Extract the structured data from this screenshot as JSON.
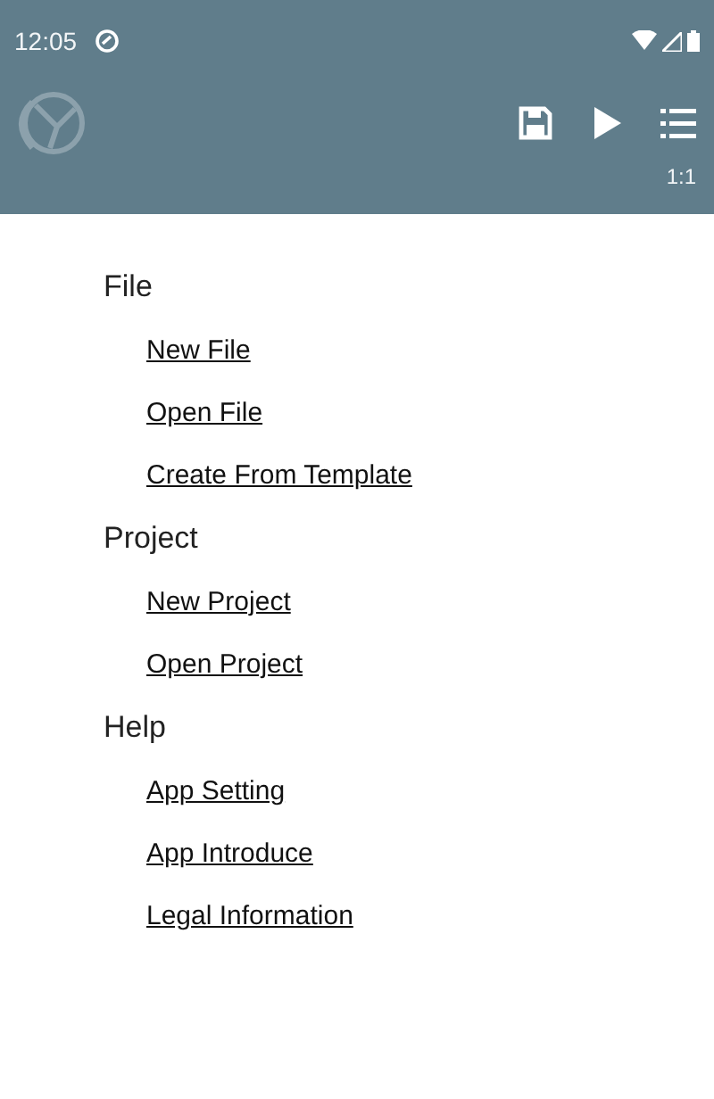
{
  "status_bar": {
    "time": "12:05"
  },
  "toolbar": {
    "zoom": "1:1"
  },
  "sections": [
    {
      "title": "File",
      "links": [
        {
          "label": "New File"
        },
        {
          "label": "Open File"
        },
        {
          "label": "Create From Template"
        }
      ]
    },
    {
      "title": "Project",
      "links": [
        {
          "label": "New Project"
        },
        {
          "label": "Open Project"
        }
      ]
    },
    {
      "title": "Help",
      "links": [
        {
          "label": "App Setting"
        },
        {
          "label": "App Introduce"
        },
        {
          "label": "Legal Information"
        }
      ]
    }
  ]
}
